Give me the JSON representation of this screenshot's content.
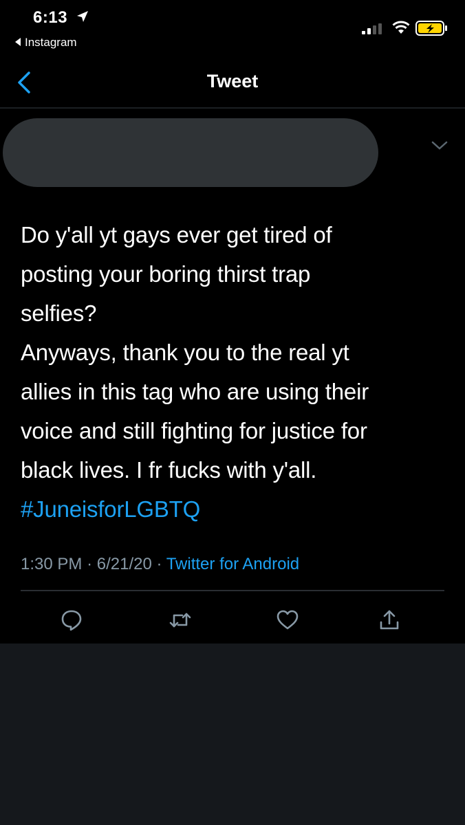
{
  "status_bar": {
    "time": "6:13",
    "back_app": "Instagram"
  },
  "nav": {
    "title": "Tweet"
  },
  "tweet": {
    "lines": [
      "Do y'all yt gays ever get tired of",
      "posting your boring thirst trap",
      "selfies?",
      "Anyways, thank you to the real yt",
      "allies in this tag who are using their",
      "voice and still fighting for justice for",
      "black lives. I fr fucks with y'all."
    ],
    "hashtag": "#JuneisforLGBTQ",
    "time": "1:30 PM",
    "separator": "·",
    "date": "6/21/20",
    "source": "Twitter for Android"
  },
  "icons": {
    "back": "chevron-left-icon",
    "caret": "chevron-down-icon",
    "reply": "reply-icon",
    "retweet": "retweet-icon",
    "like": "heart-icon",
    "share": "share-icon"
  },
  "colors": {
    "background": "#000000",
    "lower_background": "#15181c",
    "accent": "#1da1f2",
    "muted_text": "#8899a6",
    "battery": "#ffd400"
  }
}
